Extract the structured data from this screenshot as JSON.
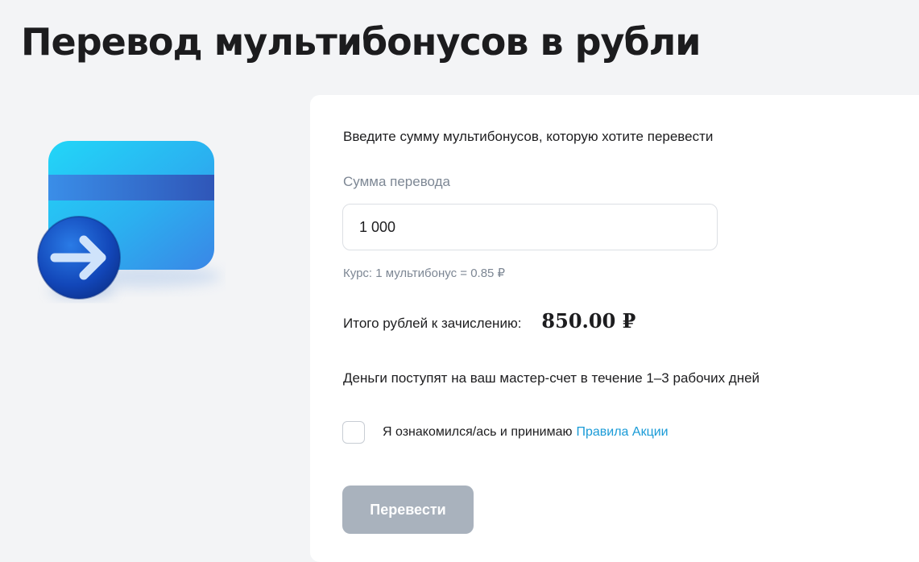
{
  "page": {
    "title": "Перевод мультибонусов в рубли"
  },
  "illustration": {
    "card_icon": "bank-card-icon",
    "arrow_icon": "arrow-right-circle-icon"
  },
  "form": {
    "instruction": "Введите сумму мультибонусов, которую хотите перевести",
    "amount_label": "Сумма перевода",
    "amount_value": "1 000",
    "rate_text": "Курс: 1 мультибонус = 0.85 ₽",
    "total_label": "Итого рублей к зачислению:",
    "total_value": "850.00 ₽",
    "delivery_note": "Деньги поступят на ваш мастер-счет в течение 1–3 рабочих дней",
    "agreement_checked": false,
    "agreement_text": "Я ознакомился/ась и принимаю",
    "rules_link": "Правила Акции",
    "submit_label": "Перевести"
  },
  "colors": {
    "background": "#f3f4f6",
    "panel": "#ffffff",
    "link": "#1a9bd7",
    "button_disabled": "#a9b2bd",
    "muted_text": "#7d8794"
  }
}
